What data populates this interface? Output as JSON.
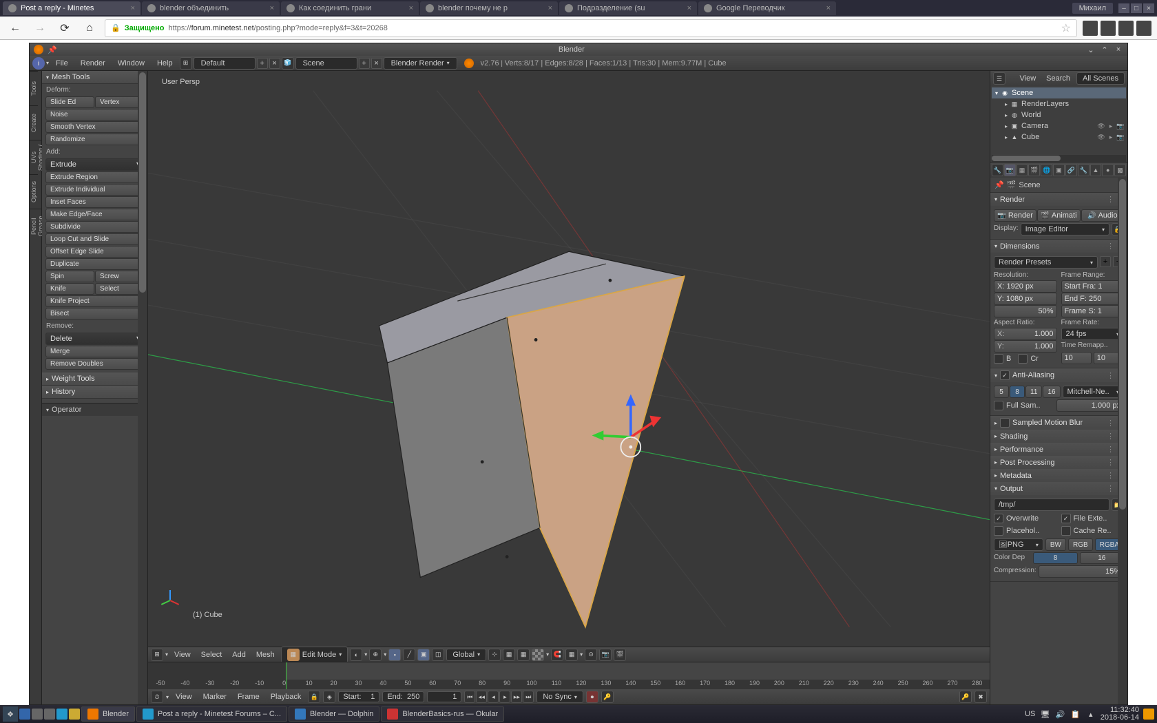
{
  "browser": {
    "tabs": [
      {
        "title": "Post a reply - Minetes",
        "active": true
      },
      {
        "title": "blender объединить",
        "active": false
      },
      {
        "title": "Как соединить грани",
        "active": false
      },
      {
        "title": "blender почему не р",
        "active": false
      },
      {
        "title": "Подразделение (su",
        "active": false
      },
      {
        "title": "Google Переводчик",
        "active": false
      }
    ],
    "user": "Михаил",
    "secure_label": "Защищено",
    "url_prefix": "https://",
    "url_domain": "forum.minetest.net",
    "url_path": "/posting.php?mode=reply&f=3&t=20268"
  },
  "blender": {
    "title": "Blender",
    "menus": {
      "file": "File",
      "render": "Render",
      "window": "Window",
      "help": "Help"
    },
    "layout": "Default",
    "scene": "Scene",
    "engine": "Blender Render",
    "version": "v2.76",
    "stats": "Verts:8/17 | Edges:8/28 | Faces:1/13 | Tris:30 | Mem:9.77M | Cube"
  },
  "vtabs": [
    "Tools",
    "Create",
    "Shading / UVs",
    "Options",
    "Grease Pencil"
  ],
  "tools": {
    "header": "Mesh Tools",
    "deform_label": "Deform:",
    "slide_ed": "Slide Ed",
    "vertex": "Vertex",
    "noise": "Noise",
    "smooth_vertex": "Smooth Vertex",
    "randomize": "Randomize",
    "add_label": "Add:",
    "extrude": "Extrude",
    "extrude_region": "Extrude Region",
    "extrude_individual": "Extrude Individual",
    "inset_faces": "Inset Faces",
    "make_edge_face": "Make Edge/Face",
    "subdivide": "Subdivide",
    "loop_cut": "Loop Cut and Slide",
    "offset_edge": "Offset Edge Slide",
    "duplicate": "Duplicate",
    "spin": "Spin",
    "screw": "Screw",
    "knife": "Knife",
    "select": "Select",
    "knife_project": "Knife Project",
    "bisect": "Bisect",
    "remove_label": "Remove:",
    "delete": "Delete",
    "merge": "Merge",
    "remove_doubles": "Remove Doubles",
    "weight_tools": "Weight Tools",
    "history": "History",
    "operator": "Operator"
  },
  "viewport": {
    "view_label": "User Persp",
    "object_label": "(1) Cube",
    "header": {
      "view": "View",
      "select": "Select",
      "add": "Add",
      "mesh": "Mesh",
      "mode": "Edit Mode",
      "orientation": "Global"
    }
  },
  "timeline": {
    "ticks": [
      "-50",
      "-40",
      "-30",
      "-20",
      "-10",
      "0",
      "10",
      "20",
      "30",
      "40",
      "50",
      "60",
      "70",
      "80",
      "90",
      "100",
      "110",
      "120",
      "130",
      "140",
      "150",
      "160",
      "170",
      "180",
      "190",
      "200",
      "210",
      "220",
      "230",
      "240",
      "250",
      "260",
      "270",
      "280"
    ],
    "menus": {
      "view": "View",
      "marker": "Marker",
      "frame": "Frame",
      "playback": "Playback"
    },
    "start_label": "Start:",
    "start_val": "1",
    "end_label": "End:",
    "end_val": "250",
    "current": "1",
    "sync": "No Sync"
  },
  "outliner": {
    "menus": {
      "view": "View",
      "search": "Search",
      "all_scenes": "All Scenes"
    },
    "tree": [
      {
        "indent": 0,
        "icon": "◉",
        "label": "Scene",
        "active": true
      },
      {
        "indent": 1,
        "icon": "▦",
        "label": "RenderLayers"
      },
      {
        "indent": 1,
        "icon": "◍",
        "label": "World"
      },
      {
        "indent": 1,
        "icon": "▣",
        "label": "Camera",
        "ctrls": true
      },
      {
        "indent": 1,
        "icon": "▲",
        "label": "Cube",
        "ctrls": true
      }
    ]
  },
  "props": {
    "crumb": "Scene",
    "render": {
      "header": "Render",
      "render_btn": "Render",
      "anim_btn": "Animati",
      "audio_btn": "Audio",
      "display_label": "Display:",
      "display_val": "Image Editor"
    },
    "dimensions": {
      "header": "Dimensions",
      "presets": "Render Presets",
      "resolution_label": "Resolution:",
      "res_x": "X: 1920 px",
      "res_y": "Y: 1080 px",
      "res_pct": "50%",
      "frame_range_label": "Frame Range:",
      "start_frame": "Start Fra: 1",
      "end_frame": "End F: 250",
      "frame_step": "Frame S: 1",
      "aspect_label": "Aspect Ratio:",
      "aspect_x": "1.000",
      "aspect_y": "1.000",
      "frame_rate_label": "Frame Rate:",
      "fps": "24 fps",
      "time_remap": "Time Remapp..",
      "border": "B",
      "crop": "Cr",
      "old": "10",
      "new": "10"
    },
    "aa": {
      "header": "Anti-Aliasing",
      "s5": "5",
      "s8": "8",
      "s11": "11",
      "s16": "16",
      "filter": "Mitchell-Ne..",
      "full_sample": "Full Sam..",
      "size": "1.000 px"
    },
    "smb": "Sampled Motion Blur",
    "shading": "Shading",
    "performance": "Performance",
    "post": "Post Processing",
    "metadata": "Metadata",
    "output": {
      "header": "Output",
      "path": "/tmp/",
      "overwrite": "Overwrite",
      "file_ext": "File Exte..",
      "placeholder": "Placehol..",
      "cache": "Cache Re..",
      "format": "PNG",
      "bw": "BW",
      "rgb": "RGB",
      "rgba": "RGBA",
      "color_depth": "Color Dep",
      "cd8": "8",
      "cd16": "16",
      "compression_label": "Compression:",
      "compression_val": "15%"
    }
  },
  "taskbar": {
    "apps": [
      {
        "label": "Blender",
        "active": true
      },
      {
        "label": "Post a reply - Minetest Forums – C..."
      },
      {
        "label": "Blender — Dolphin"
      },
      {
        "label": "BlenderBasics-rus — Okular"
      }
    ],
    "lang": "US",
    "time": "11:32:40",
    "date": "2018-06-14"
  }
}
